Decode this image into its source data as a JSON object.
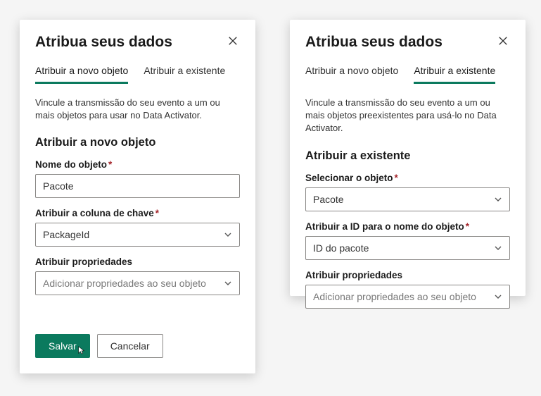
{
  "left": {
    "title": "Atribua seus dados",
    "tabs": {
      "new": "Atribuir a novo objeto",
      "existing": "Atribuir a existente"
    },
    "desc": "Vincule a transmissão do seu evento a um ou mais objetos para usar no Data Activator.",
    "section_title": "Atribuir a novo objeto",
    "fields": {
      "object_name_label": "Nome do objeto",
      "object_name_value": "Pacote",
      "key_col_label": "Atribuir a coluna de chave",
      "key_col_value": "PackageId",
      "props_label": "Atribuir propriedades",
      "props_placeholder": "Adicionar propriedades ao seu objeto"
    },
    "buttons": {
      "save": "Salvar",
      "cancel": "Cancelar"
    }
  },
  "right": {
    "title": "Atribua seus dados",
    "tabs": {
      "new": "Atribuir a novo objeto",
      "existing": "Atribuir a existente"
    },
    "desc": "Vincule a transmissão do seu evento a um ou mais objetos preexistentes para usá-lo no Data Activator.",
    "section_title": "Atribuir a existente",
    "fields": {
      "select_obj_label": "Selecionar o objeto",
      "select_obj_value": "Pacote",
      "id_label": "Atribuir a ID para o nome do objeto",
      "id_value": "ID do pacote",
      "props_label": "Atribuir propriedades",
      "props_placeholder": "Adicionar propriedades ao seu objeto"
    }
  }
}
